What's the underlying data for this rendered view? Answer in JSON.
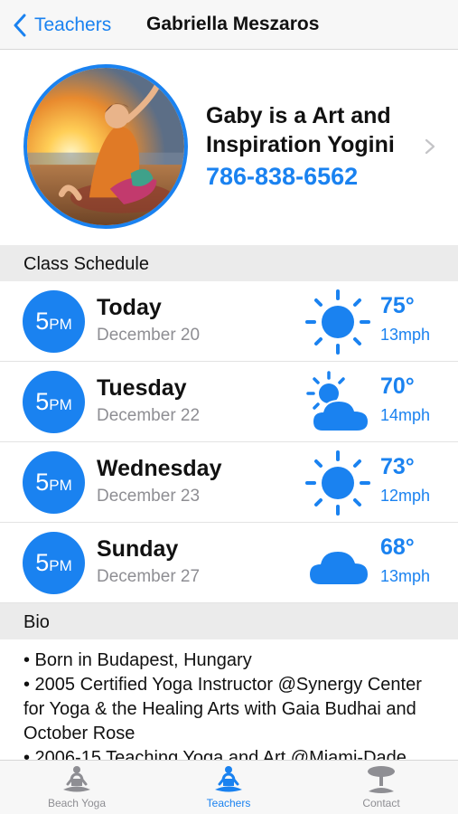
{
  "nav": {
    "back_label": "Teachers",
    "title": "Gabriella Meszaros"
  },
  "profile": {
    "headline": "Gaby is a Art and Inspiration Yogini",
    "phone": "786-838-6562"
  },
  "schedule": {
    "header": "Class Schedule",
    "rows": [
      {
        "time": "5",
        "unit": "PM",
        "day": "Today",
        "date": "December 20",
        "weather_icon": "sun-icon",
        "temp": "75°",
        "wind": "13mph"
      },
      {
        "time": "5",
        "unit": "PM",
        "day": "Tuesday",
        "date": "December 22",
        "weather_icon": "partly-cloudy-icon",
        "temp": "70°",
        "wind": "14mph"
      },
      {
        "time": "5",
        "unit": "PM",
        "day": "Wednesday",
        "date": "December 23",
        "weather_icon": "sun-icon",
        "temp": "73°",
        "wind": "12mph"
      },
      {
        "time": "5",
        "unit": "PM",
        "day": "Sunday",
        "date": "December 27",
        "weather_icon": "cloud-icon",
        "temp": "68°",
        "wind": "13mph"
      }
    ]
  },
  "bio": {
    "header": "Bio",
    "lines": [
      "• Born in Budapest, Hungary",
      "• 2005 Certified Yoga Instructor @Synergy Center for Yoga & the Healing Arts with Gaia Budhai and October Rose",
      "• 2006-15 Teaching Yoga and Art @Miami-Dade"
    ]
  },
  "tabs": [
    {
      "label": "Beach Yoga",
      "icon": "meditation-icon",
      "active": false
    },
    {
      "label": "Teachers",
      "icon": "meditation-icon",
      "active": true
    },
    {
      "label": "Contact",
      "icon": "tree-icon",
      "active": false
    }
  ],
  "colors": {
    "accent": "#1a82f0",
    "secondary_text": "#8e8e93",
    "section_bg": "#ebebeb"
  }
}
